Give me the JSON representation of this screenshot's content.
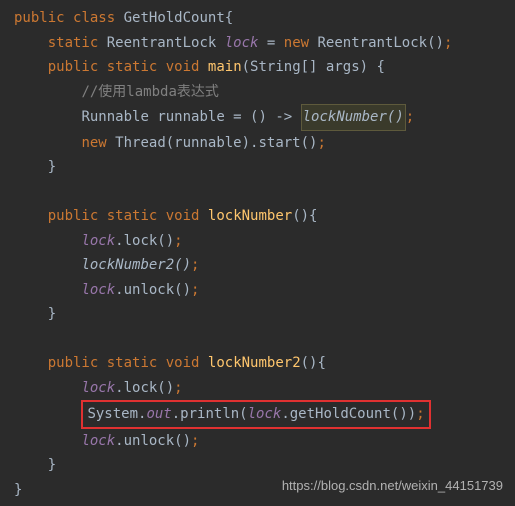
{
  "lines": {
    "l1_kw1": "public",
    "l1_kw2": "class",
    "l1_cls": "GetHoldCount",
    "l1_brace": "{",
    "l2_kw1": "static",
    "l2_type": "ReentrantLock",
    "l2_field": "lock",
    "l2_eq": " = ",
    "l2_kw2": "new",
    "l2_ctor": "ReentrantLock()",
    "l2_semi": ";",
    "l3_kw1": "public",
    "l3_kw2": "static",
    "l3_kw3": "void",
    "l3_method": "main",
    "l3_params": "(String[] args) {",
    "l4_comment": "//使用lambda表达式",
    "l5_type": "Runnable",
    "l5_var": "runnable = () -> ",
    "l5_call": "lockNumber()",
    "l5_semi": ";",
    "l6_kw": "new",
    "l6_rest": "Thread(runnable).start()",
    "l6_semi": ";",
    "l7_brace": "}",
    "l9_kw1": "public",
    "l9_kw2": "static",
    "l9_kw3": "void",
    "l9_method": "lockNumber",
    "l9_paren": "(){",
    "l10_field": "lock",
    "l10_call": ".lock()",
    "l10_semi": ";",
    "l11_call": "lockNumber2()",
    "l11_semi": ";",
    "l12_field": "lock",
    "l12_call": ".unlock()",
    "l12_semi": ";",
    "l13_brace": "}",
    "l15_kw1": "public",
    "l15_kw2": "static",
    "l15_kw3": "void",
    "l15_method": "lockNumber2",
    "l15_paren": "(){",
    "l16_field": "lock",
    "l16_call": ".lock()",
    "l16_semi": ";",
    "l17_sys": "System.",
    "l17_out": "out",
    "l17_print": ".println(",
    "l17_field": "lock",
    "l17_get": ".getHoldCount())",
    "l17_semi": ";",
    "l18_field": "lock",
    "l18_call": ".unlock()",
    "l18_semi": ";",
    "l19_brace": "}",
    "l20_brace": "}"
  },
  "watermark": "https://blog.csdn.net/weixin_44151739"
}
